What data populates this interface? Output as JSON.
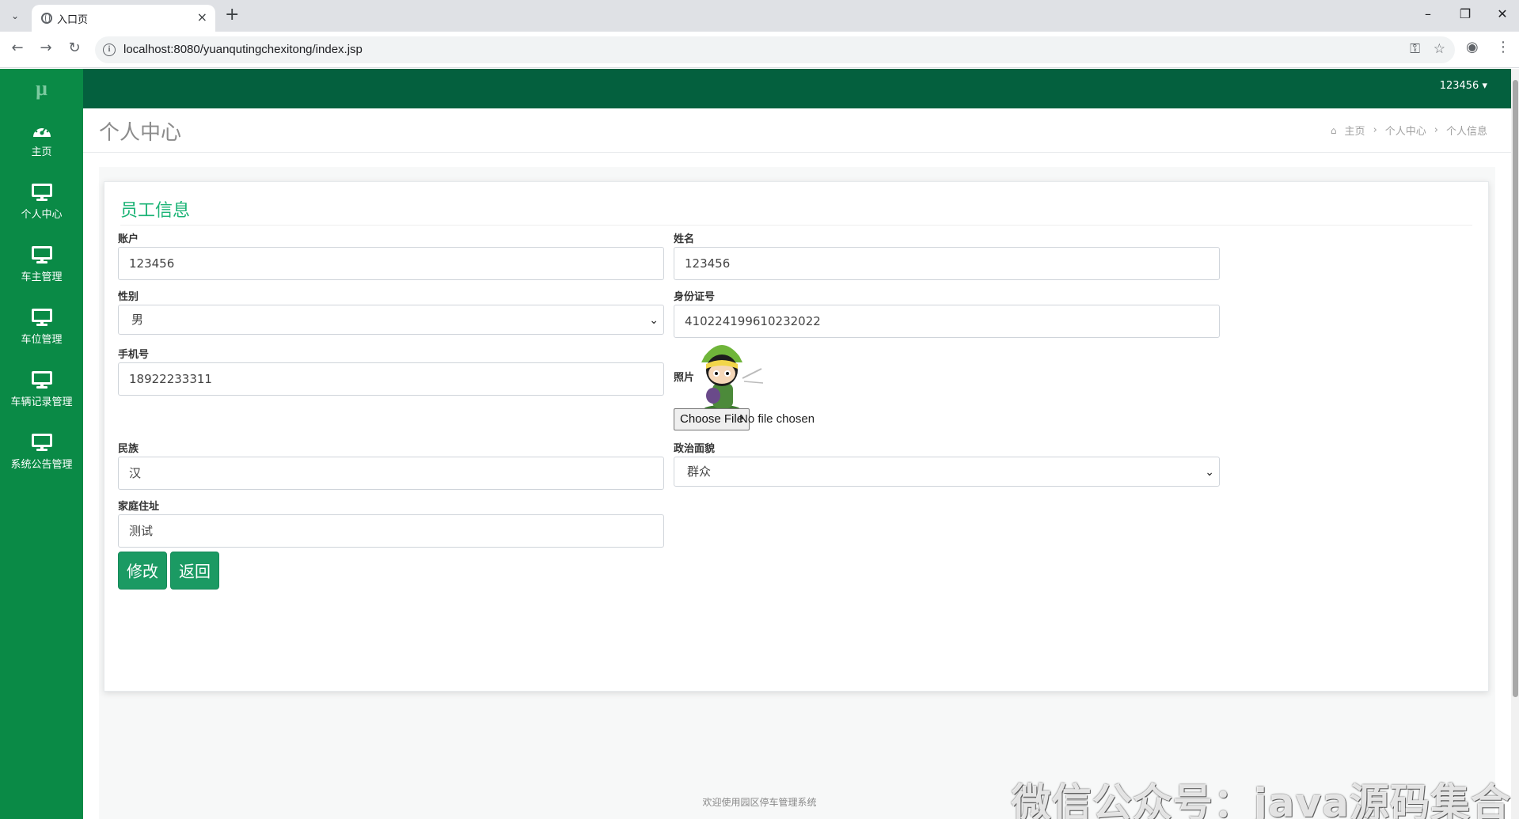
{
  "browser": {
    "tab_title": "入口页",
    "url": "localhost:8080/yuanqutingchexitong/index.jsp"
  },
  "sidebar": {
    "logo": "μ",
    "items": [
      {
        "label": "主页",
        "icon": "dashboard-icon"
      },
      {
        "label": "个人中心",
        "icon": "monitor-icon"
      },
      {
        "label": "车主管理",
        "icon": "monitor-icon"
      },
      {
        "label": "车位管理",
        "icon": "monitor-icon"
      },
      {
        "label": "车辆记录管理",
        "icon": "monitor-icon"
      },
      {
        "label": "系统公告管理",
        "icon": "monitor-icon"
      }
    ]
  },
  "topnav": {
    "user": "123456",
    "caret": "▾"
  },
  "header": {
    "title": "个人中心",
    "breadcrumb": [
      "主页",
      "个人中心",
      "个人信息"
    ],
    "separator": "›"
  },
  "form": {
    "title": "员工信息",
    "account_label": "账户",
    "account_value": "123456",
    "name_label": "姓名",
    "name_value": "123456",
    "gender_label": "性别",
    "gender_value": "男",
    "idcard_label": "身份证号",
    "idcard_value": "410224199610232022",
    "phone_label": "手机号",
    "phone_value": "18922233311",
    "photo_label": "照片",
    "file_button": "Choose File",
    "file_status": "No file chosen",
    "ethnic_label": "民族",
    "ethnic_value": "汉",
    "political_label": "政治面貌",
    "political_value": "群众",
    "address_label": "家庭住址",
    "address_value": "测试",
    "edit_button": "修改",
    "back_button": "返回"
  },
  "footer": {
    "text": "欢迎使用园区停车管理系统"
  },
  "watermark": "微信公众号：java源码集合",
  "colors": {
    "sidebar": "#0a8a46",
    "topnav": "#04603e",
    "accent": "#1ab375",
    "button": "#1b9a63"
  }
}
